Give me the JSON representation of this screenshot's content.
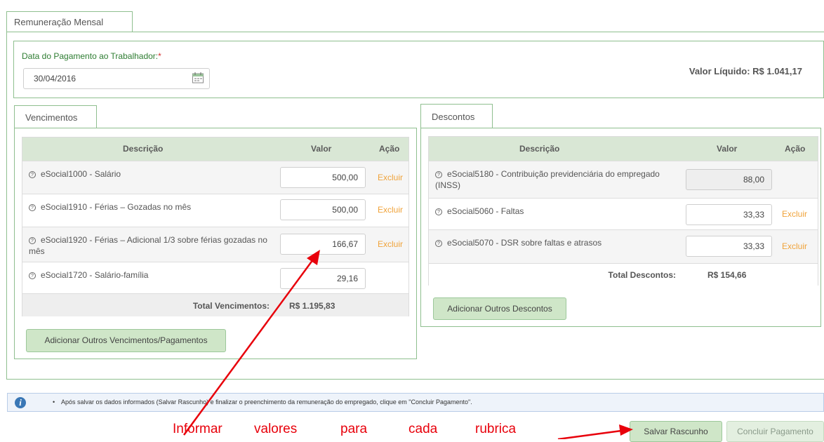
{
  "tabs": {
    "main": "Remuneração Mensal",
    "vencimentos": "Vencimentos",
    "descontos": "Descontos"
  },
  "header": {
    "date_label": "Data do Pagamento ao Trabalhador:",
    "required_mark": "*",
    "date_value": "30/04/2016",
    "net_value": "Valor Líquido: R$ 1.041,17"
  },
  "table_headers": {
    "descricao": "Descrição",
    "valor": "Valor",
    "acao": "Ação"
  },
  "vencimentos": {
    "rows": [
      {
        "descricao": "eSocial1000 - Salário",
        "valor": "500,00",
        "acao": "Excluir"
      },
      {
        "descricao": "eSocial1910 - Férias – Gozadas no mês",
        "valor": "500,00",
        "acao": "Excluir"
      },
      {
        "descricao": "eSocial1920 - Férias – Adicional 1/3 sobre férias gozadas no mês",
        "valor": "166,67",
        "acao": "Excluir"
      },
      {
        "descricao": "eSocial1720 - Salário-família",
        "valor": "29,16",
        "acao": ""
      }
    ],
    "total_label": "Total Vencimentos:",
    "total_value": "R$ 1.195,83",
    "add_button": "Adicionar Outros Vencimentos/Pagamentos"
  },
  "descontos": {
    "rows": [
      {
        "descricao": "eSocial5180 - Contribuição previdenciária do empregado (INSS)",
        "valor": "88,00",
        "acao": ""
      },
      {
        "descricao": "eSocial5060 - Faltas",
        "valor": "33,33",
        "acao": "Excluir"
      },
      {
        "descricao": "eSocial5070 - DSR sobre faltas e atrasos",
        "valor": "33,33",
        "acao": "Excluir"
      }
    ],
    "total_label": "Total Descontos:",
    "total_value": "R$ 154,66",
    "add_button": "Adicionar Outros Descontos"
  },
  "info": {
    "text": "Após salvar os dados informados (Salvar Rascunho) e finalizar o preenchimento da remuneração do empregado, clique em \"Concluir Pagamento\"."
  },
  "actions": {
    "save_draft": "Salvar Rascunho",
    "conclude": "Concluir Pagamento"
  },
  "annotation": {
    "words": [
      "Informar",
      "valores",
      "para",
      "cada",
      "rubrica"
    ]
  },
  "icons": {
    "calendar": "calendar-icon",
    "help": "help-circle-icon",
    "info": "info-icon"
  },
  "colors": {
    "accent_green": "#8fbf8f",
    "header_green": "#d9e7d5",
    "link_orange": "#f0a33a",
    "annotation_red": "#e8000b",
    "info_blue": "#3a77b5"
  }
}
